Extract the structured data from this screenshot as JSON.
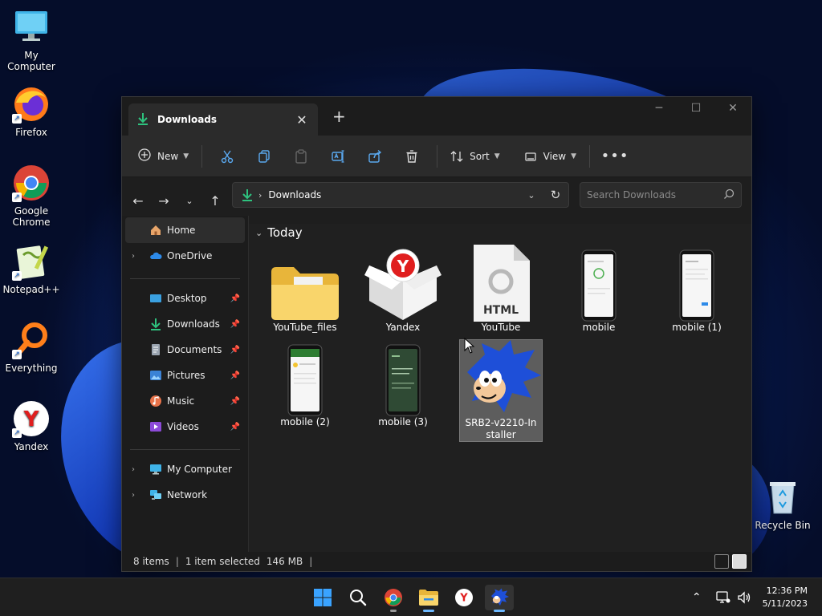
{
  "desktop": {
    "icons": [
      {
        "label": "My Computer"
      },
      {
        "label": "Firefox"
      },
      {
        "label": "Google Chrome"
      },
      {
        "label": "Notepad++"
      },
      {
        "label": "Everything"
      },
      {
        "label": "Yandex"
      },
      {
        "label": "Recycle Bin"
      }
    ]
  },
  "window": {
    "tab_title": "Downloads",
    "toolbar": {
      "new_label": "New",
      "sort_label": "Sort",
      "view_label": "View"
    },
    "address": {
      "path": "Downloads",
      "search_placeholder": "Search Downloads"
    },
    "sidebar": {
      "home": "Home",
      "onedrive": "OneDrive",
      "desktop": "Desktop",
      "downloads": "Downloads",
      "documents": "Documents",
      "pictures": "Pictures",
      "music": "Music",
      "videos": "Videos",
      "mycomputer": "My Computer",
      "network": "Network"
    },
    "group_header": "Today",
    "files": [
      {
        "name": "YouTube_files"
      },
      {
        "name": "Yandex"
      },
      {
        "name": "YouTube"
      },
      {
        "name": "mobile"
      },
      {
        "name": "mobile (1)"
      },
      {
        "name": "mobile (2)"
      },
      {
        "name": "mobile (3)"
      },
      {
        "name": "SRB2-v2210-Installer"
      }
    ],
    "html_badge": "HTML",
    "status": {
      "items": "8 items",
      "selected": "1 item selected",
      "size": "146 MB"
    }
  },
  "taskbar": {
    "time": "12:36 PM",
    "date": "5/11/2023"
  }
}
